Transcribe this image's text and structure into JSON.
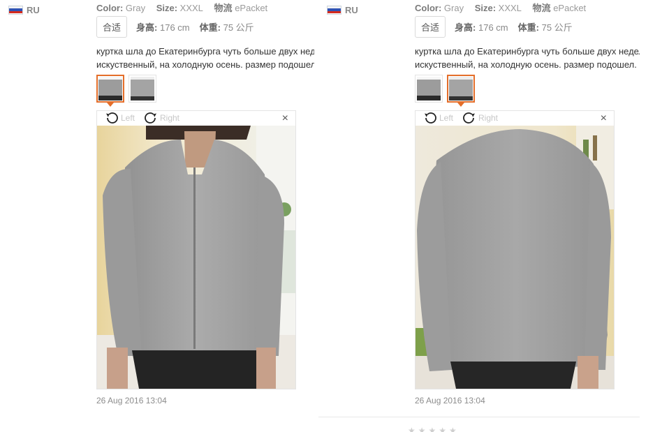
{
  "reviews": [
    {
      "country": "RU",
      "attrs": {
        "color_label": "Color:",
        "color_value": "Gray",
        "size_label": "Size:",
        "size_value": "XXXL",
        "logistics_label": "物流",
        "logistics_value": "ePacket"
      },
      "fit": {
        "badge": "合适",
        "height_label": "身高:",
        "height_value": "176 cm",
        "weight_label": "体重:",
        "weight_value": "75 公斤"
      },
      "text": {
        "line1": "куртка шла до Екатеринбурга чуть больше двух недель, без опоздания. материал приятный, но",
        "line2": "искуственный, на холодную осень. размер подошел. продавец отправил быстро, советую."
      },
      "viewer": {
        "rotate_left": "Left",
        "rotate_right": "Right",
        "close": "×"
      },
      "active_thumb": 0,
      "date": "26 Aug 2016 13:04"
    },
    {
      "country": "RU",
      "attrs": {
        "color_label": "Color:",
        "color_value": "Gray",
        "size_label": "Size:",
        "size_value": "XXXL",
        "logistics_label": "物流",
        "logistics_value": "ePacket"
      },
      "fit": {
        "badge": "合适",
        "height_label": "身高:",
        "height_value": "176 cm",
        "weight_label": "体重:",
        "weight_value": "75 公斤"
      },
      "text": {
        "line1": "куртка шла до Екатеринбурга чуть больше двух недель, без опоздания. материал приятный, но",
        "line2": "искуственный, на холодную осень. размер подошел. продавец отправил быстро, советую."
      },
      "viewer": {
        "rotate_left": "Left",
        "rotate_right": "Right",
        "close": "×"
      },
      "active_thumb": 1,
      "date": "26 Aug 2016 13:04"
    }
  ],
  "colors": {
    "accent": "#e46e2a",
    "jacket": "#a3a3a3"
  },
  "icons": [
    "rotate-left-icon",
    "rotate-right-icon",
    "close-icon",
    "flag-ru-icon"
  ]
}
